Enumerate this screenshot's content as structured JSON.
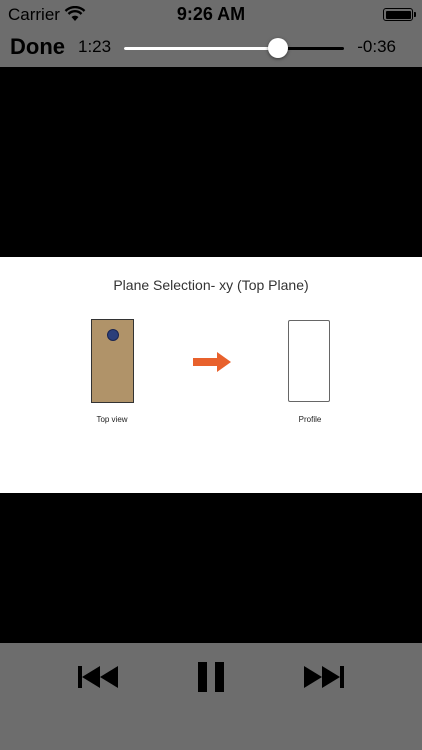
{
  "status_bar": {
    "carrier": "Carrier",
    "time": "9:26 AM"
  },
  "player": {
    "done_label": "Done",
    "elapsed": "1:23",
    "remaining": "-0:36",
    "progress_fraction": 0.7
  },
  "slide": {
    "title": "Plane Selection- xy (Top Plane)",
    "left_caption": "Top view",
    "right_caption": "Profile",
    "colors": {
      "block": "#b09369",
      "hole": "#2b3f7a",
      "arrow": "#e8612c"
    }
  },
  "controls": {
    "icons": [
      "rewind-icon",
      "pause-icon",
      "fast-forward-icon"
    ]
  }
}
